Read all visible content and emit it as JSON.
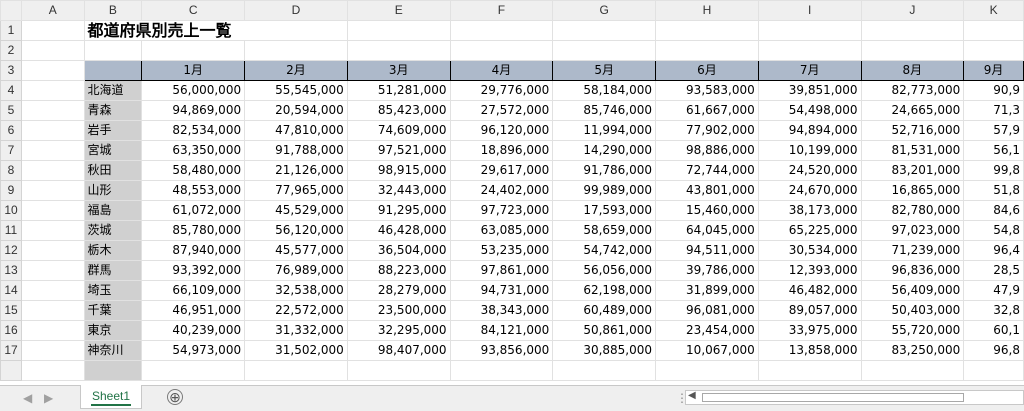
{
  "sheet": {
    "columns": [
      "A",
      "B",
      "C",
      "D",
      "E",
      "F",
      "G",
      "H",
      "I",
      "J",
      "K"
    ],
    "title": "都道府県別売上一覧",
    "months": [
      "1月",
      "2月",
      "3月",
      "4月",
      "5月",
      "6月",
      "7月",
      "8月",
      "9月"
    ],
    "rows": [
      {
        "num": "4",
        "pref": "北海道",
        "values": [
          "56,000,000",
          "55,545,000",
          "51,281,000",
          "29,776,000",
          "58,184,000",
          "93,583,000",
          "39,851,000",
          "82,773,000",
          "90,9"
        ]
      },
      {
        "num": "5",
        "pref": "青森",
        "values": [
          "94,869,000",
          "20,594,000",
          "85,423,000",
          "27,572,000",
          "85,746,000",
          "61,667,000",
          "54,498,000",
          "24,665,000",
          "71,3"
        ]
      },
      {
        "num": "6",
        "pref": "岩手",
        "values": [
          "82,534,000",
          "47,810,000",
          "74,609,000",
          "96,120,000",
          "11,994,000",
          "77,902,000",
          "94,894,000",
          "52,716,000",
          "57,9"
        ]
      },
      {
        "num": "7",
        "pref": "宮城",
        "values": [
          "63,350,000",
          "91,788,000",
          "97,521,000",
          "18,896,000",
          "14,290,000",
          "98,886,000",
          "10,199,000",
          "81,531,000",
          "56,1"
        ]
      },
      {
        "num": "8",
        "pref": "秋田",
        "values": [
          "58,480,000",
          "21,126,000",
          "98,915,000",
          "29,617,000",
          "91,786,000",
          "72,744,000",
          "24,520,000",
          "83,201,000",
          "99,8"
        ]
      },
      {
        "num": "9",
        "pref": "山形",
        "values": [
          "48,553,000",
          "77,965,000",
          "32,443,000",
          "24,402,000",
          "99,989,000",
          "43,801,000",
          "24,670,000",
          "16,865,000",
          "51,8"
        ]
      },
      {
        "num": "10",
        "pref": "福島",
        "values": [
          "61,072,000",
          "45,529,000",
          "91,295,000",
          "97,723,000",
          "17,593,000",
          "15,460,000",
          "38,173,000",
          "82,780,000",
          "84,6"
        ]
      },
      {
        "num": "11",
        "pref": "茨城",
        "values": [
          "85,780,000",
          "56,120,000",
          "46,428,000",
          "63,085,000",
          "58,659,000",
          "64,045,000",
          "65,225,000",
          "97,023,000",
          "54,8"
        ]
      },
      {
        "num": "12",
        "pref": "栃木",
        "values": [
          "87,940,000",
          "45,577,000",
          "36,504,000",
          "53,235,000",
          "54,742,000",
          "94,511,000",
          "30,534,000",
          "71,239,000",
          "96,4"
        ]
      },
      {
        "num": "13",
        "pref": "群馬",
        "values": [
          "93,392,000",
          "76,989,000",
          "88,223,000",
          "97,861,000",
          "56,056,000",
          "39,786,000",
          "12,393,000",
          "96,836,000",
          "28,5"
        ]
      },
      {
        "num": "14",
        "pref": "埼玉",
        "values": [
          "66,109,000",
          "32,538,000",
          "28,279,000",
          "94,731,000",
          "62,198,000",
          "31,899,000",
          "46,482,000",
          "56,409,000",
          "47,9"
        ]
      },
      {
        "num": "15",
        "pref": "千葉",
        "values": [
          "46,951,000",
          "22,572,000",
          "23,500,000",
          "38,343,000",
          "60,489,000",
          "96,081,000",
          "89,057,000",
          "50,403,000",
          "32,8"
        ]
      },
      {
        "num": "16",
        "pref": "東京",
        "values": [
          "40,239,000",
          "31,332,000",
          "32,295,000",
          "84,121,000",
          "50,861,000",
          "23,454,000",
          "33,975,000",
          "55,720,000",
          "60,1"
        ]
      },
      {
        "num": "17",
        "pref": "神奈川",
        "values": [
          "54,973,000",
          "31,502,000",
          "98,407,000",
          "93,856,000",
          "30,885,000",
          "10,067,000",
          "13,858,000",
          "83,250,000",
          "96,8"
        ]
      }
    ]
  },
  "tabs": {
    "sheet1": "Sheet1",
    "add_symbol": "⊕",
    "nav_prev": "◀",
    "nav_next": "▶",
    "scroll_left": "◀"
  }
}
